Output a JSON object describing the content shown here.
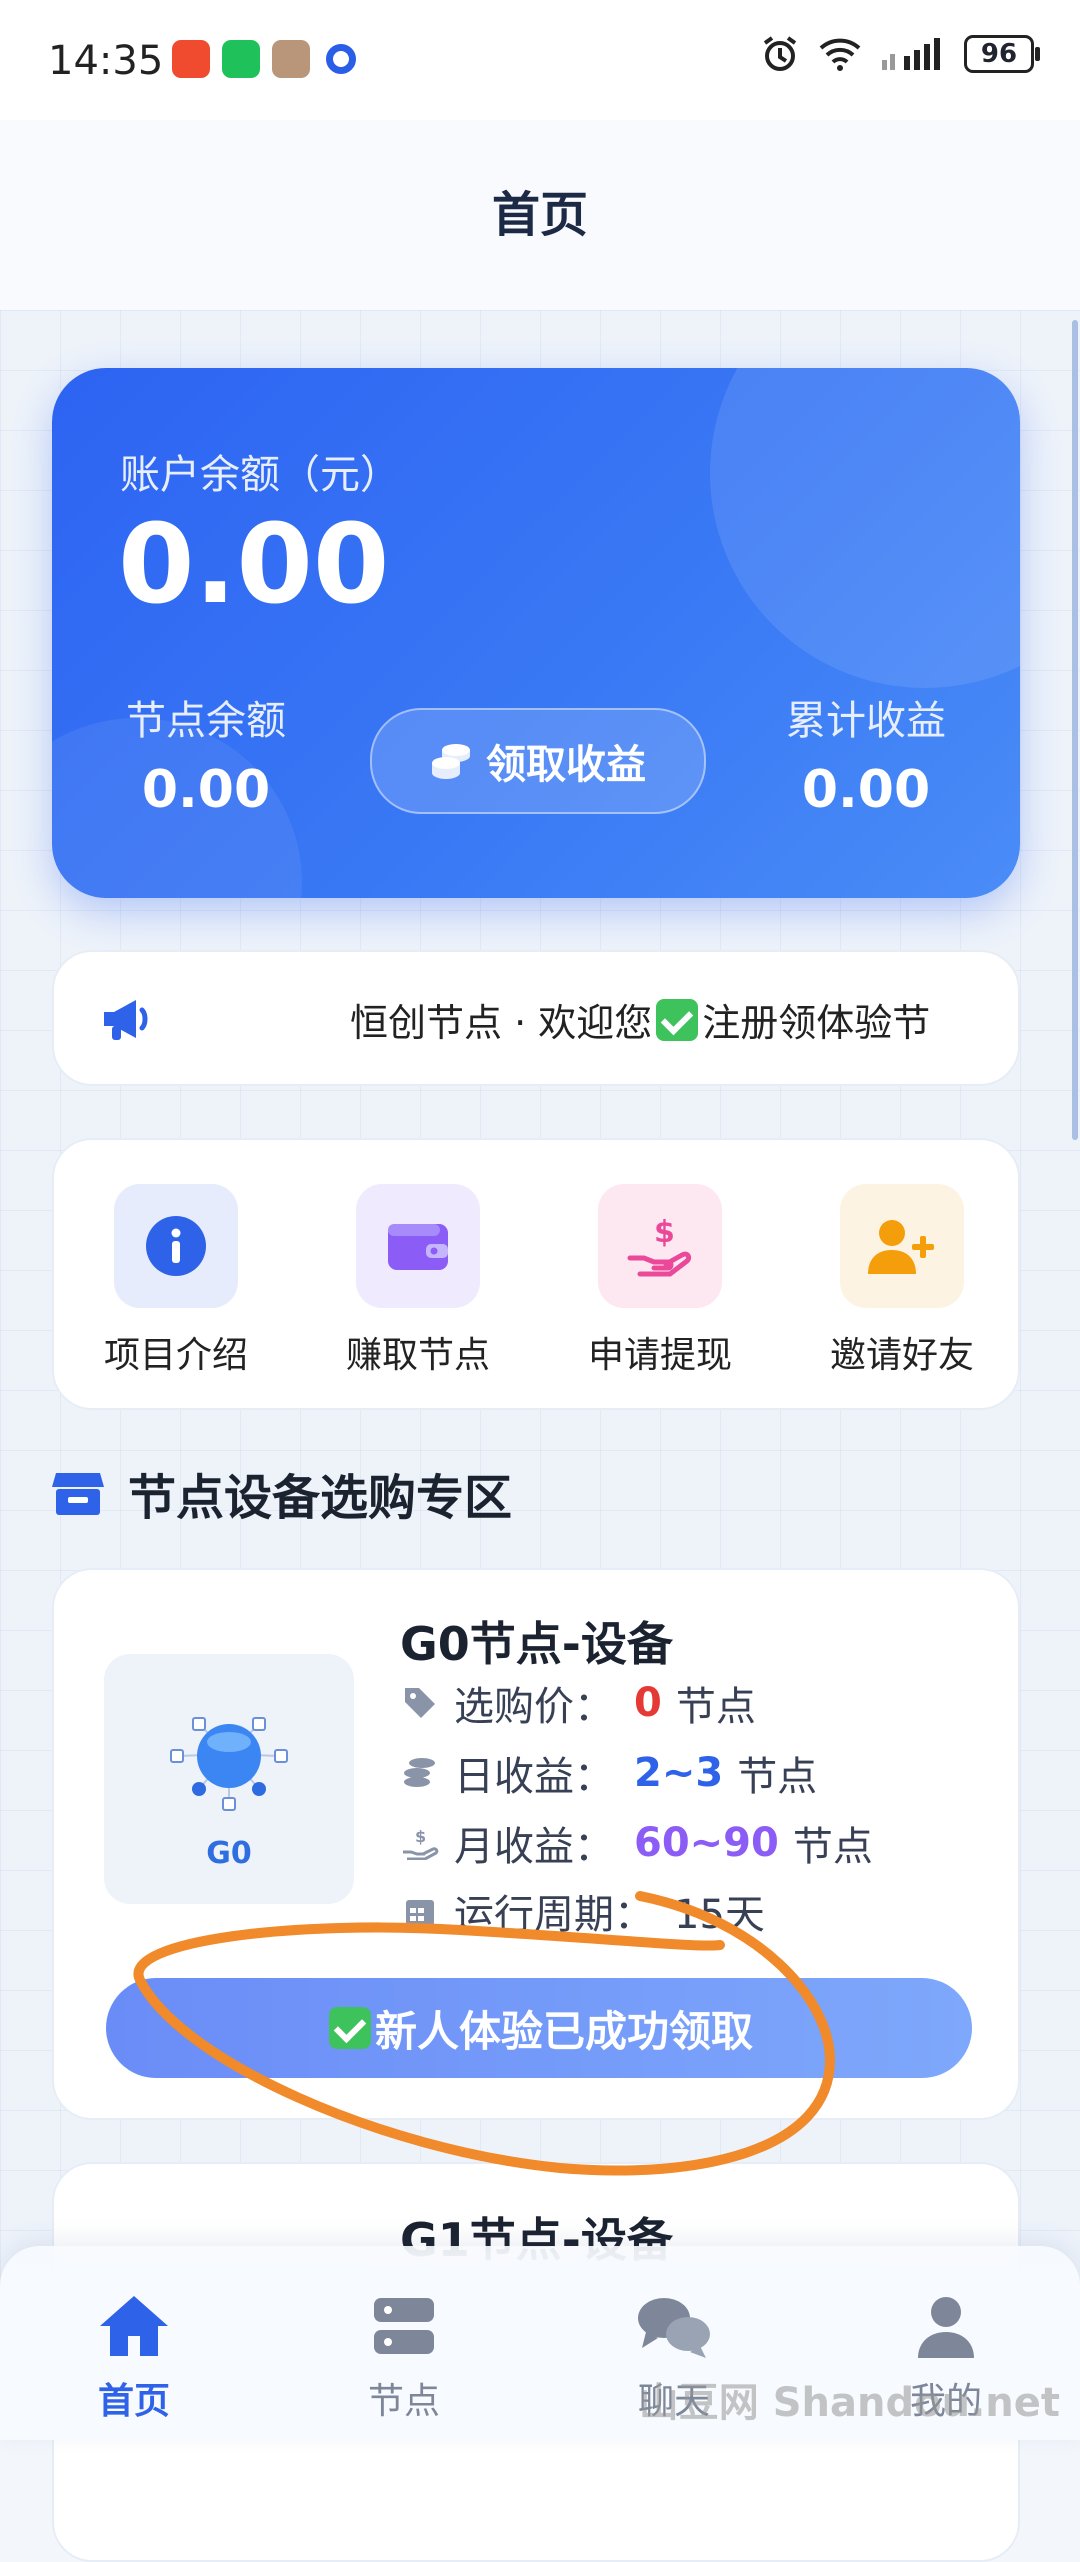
{
  "status_bar": {
    "time": "14:35",
    "battery": "96"
  },
  "header": {
    "title": "首页"
  },
  "balance_card": {
    "label": "账户余额（元）",
    "value": "0.00",
    "node_balance_label": "节点余额",
    "node_balance_value": "0.00",
    "claim_button": "领取收益",
    "total_earnings_label": "累计收益",
    "total_earnings_value": "0.00"
  },
  "notice": {
    "text_before": "恒创节点 · 欢迎您",
    "text_after": "注册领体验节"
  },
  "quick_actions": [
    {
      "label": "项目介绍",
      "icon": "info-icon",
      "color": "#2e62e8"
    },
    {
      "label": "赚取节点",
      "icon": "wallet-icon",
      "color": "#8b5cf6"
    },
    {
      "label": "申请提现",
      "icon": "hand-dollar-icon",
      "color": "#ec4899"
    },
    {
      "label": "邀请好友",
      "icon": "add-user-icon",
      "color": "#f59e0b"
    }
  ],
  "section": {
    "title": "节点设备选购专区"
  },
  "products": [
    {
      "name": "G0节点-设备",
      "image_label": "G0",
      "price_label": "选购价：",
      "price_value": "0",
      "price_unit": "节点",
      "daily_label": "日收益：",
      "daily_value": "2~3",
      "daily_unit": "节点",
      "monthly_label": "月收益：",
      "monthly_value": "60~90",
      "monthly_unit": "节点",
      "cycle_label": "运行周期：",
      "cycle_value": "15天",
      "button": "新人体验已成功领取"
    },
    {
      "name": "G1节点-设备"
    }
  ],
  "tabbar": [
    {
      "label": "首页",
      "icon": "home-icon",
      "active": true
    },
    {
      "label": "节点",
      "icon": "server-icon",
      "active": false
    },
    {
      "label": "聊天",
      "icon": "chat-icon",
      "active": false
    },
    {
      "label": "我的",
      "icon": "user-icon",
      "active": false
    }
  ],
  "watermark": "山豆网 Shandou.net",
  "colors": {
    "primary": "#2d63f2",
    "price": "#e53935",
    "daily": "#2e62e8",
    "monthly": "#8b5cf6"
  }
}
